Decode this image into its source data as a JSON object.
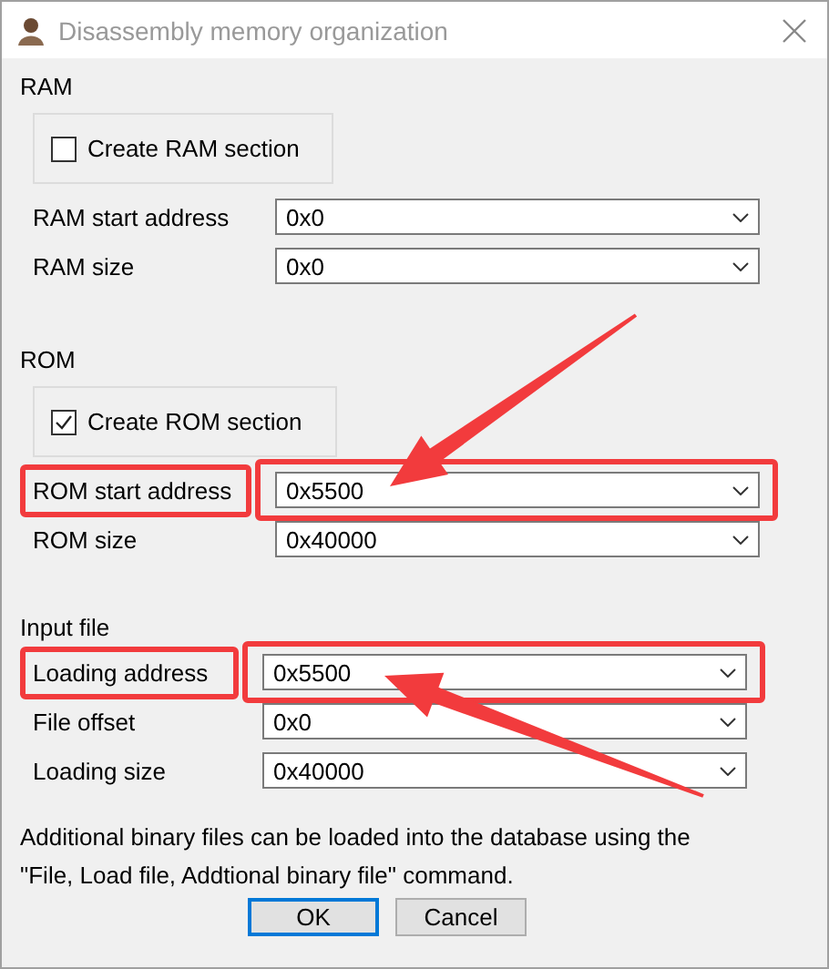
{
  "window": {
    "title": "Disassembly memory organization"
  },
  "sections": [
    {
      "title": "RAM",
      "checkbox": {
        "label": "Create RAM section",
        "checked": false
      },
      "fields": [
        {
          "label": "RAM start address",
          "value": "0x0",
          "highlighted": false
        },
        {
          "label": "RAM size",
          "value": "0x0",
          "highlighted": false
        }
      ]
    },
    {
      "title": "ROM",
      "checkbox": {
        "label": "Create ROM section",
        "checked": true
      },
      "fields": [
        {
          "label": "ROM start address",
          "value": "0x5500",
          "highlighted": true
        },
        {
          "label": "ROM size",
          "value": "0x40000",
          "highlighted": false
        }
      ]
    },
    {
      "title": "Input file",
      "fields": [
        {
          "label": "Loading address",
          "value": "0x5500",
          "highlighted": true
        },
        {
          "label": "File offset",
          "value": "0x0",
          "highlighted": false
        },
        {
          "label": "Loading size",
          "value": "0x40000",
          "highlighted": false
        }
      ]
    }
  ],
  "note": "Additional binary files can be loaded into the database using the \"File, Load file, Addtional binary file\" command.",
  "buttons": [
    {
      "label": "OK",
      "default": true
    },
    {
      "label": "Cancel",
      "default": false
    }
  ]
}
